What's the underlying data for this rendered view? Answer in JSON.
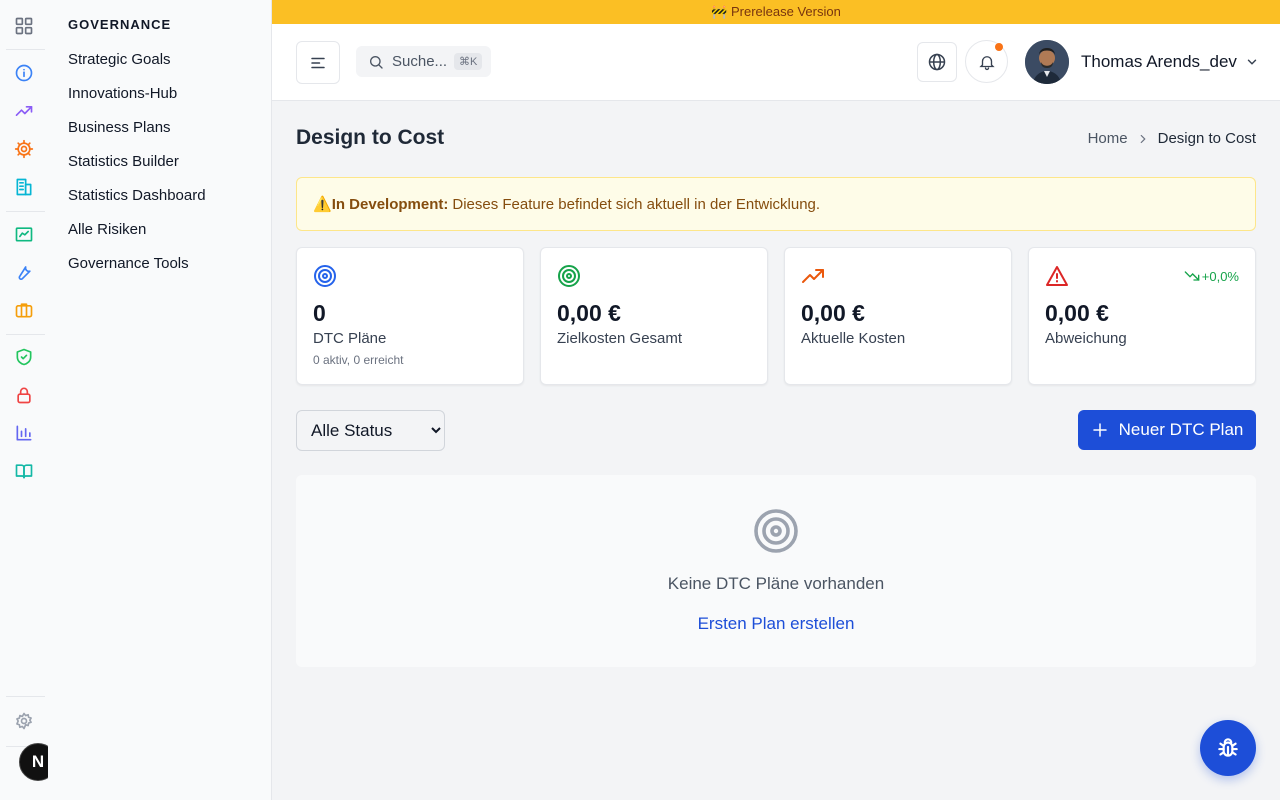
{
  "prerelease": {
    "text": "🚧 Prerelease Version",
    "color": "#fbbf24"
  },
  "rail": {
    "icons": [
      "dashboard-icon",
      "info-icon",
      "trending-up-icon",
      "cog-icon",
      "building-icon",
      "chart-box-icon",
      "wrench-icon",
      "briefcase-icon",
      "shield-check-icon",
      "lock-icon",
      "bar-chart-icon",
      "book-open-icon",
      "settings-icon"
    ]
  },
  "subnav": {
    "title": "GOVERNANCE",
    "items": [
      {
        "label": "Strategic Goals"
      },
      {
        "label": "Innovations-Hub"
      },
      {
        "label": "Business Plans"
      },
      {
        "label": "Statistics Builder"
      },
      {
        "label": "Statistics Dashboard"
      },
      {
        "label": "Alle Risiken"
      },
      {
        "label": "Governance Tools"
      }
    ]
  },
  "header": {
    "search_placeholder": "Suche...",
    "search_shortcut": "⌘K",
    "user_name": "Thomas Arends_dev"
  },
  "page": {
    "title": "Design to Cost",
    "breadcrumb": {
      "home": "Home",
      "current": "Design to Cost"
    }
  },
  "banner": {
    "icon": "⚠️",
    "strong": "In Development:",
    "text": "Dieses Feature befindet sich aktuell in der Entwicklung."
  },
  "stats": [
    {
      "icon": "target-icon",
      "value": "0",
      "label": "DTC Pläne",
      "sub": "0 aktiv, 0 erreicht",
      "color": "#2563eb"
    },
    {
      "icon": "target-icon",
      "value": "0,00 €",
      "label": "Zielkosten Gesamt",
      "color": "#16a34a"
    },
    {
      "icon": "trending-up-icon",
      "value": "0,00 €",
      "label": "Aktuelle Kosten",
      "color": "#ea580c"
    },
    {
      "icon": "alert-triangle-icon",
      "value": "0,00 €",
      "label": "Abweichung",
      "trend": "+0,0%",
      "color": "#dc2626"
    }
  ],
  "filter": {
    "selected": "Alle Status"
  },
  "actions": {
    "new_plan": "Neuer DTC Plan"
  },
  "empty": {
    "text": "Keine DTC Pläne vorhanden",
    "link": "Ersten Plan erstellen"
  },
  "badge": {
    "letter": "N"
  }
}
